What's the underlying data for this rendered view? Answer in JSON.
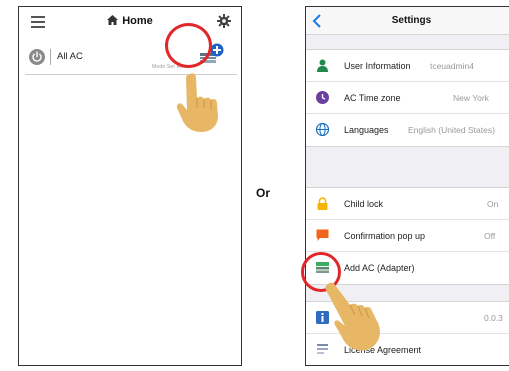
{
  "home_screen": {
    "title": "Home",
    "ac_item": {
      "name": "All AC",
      "status_labels": "Mode   Set   Room"
    }
  },
  "separator": {
    "label": "Or"
  },
  "settings_screen": {
    "title": "Settings",
    "section_1": [
      {
        "label": "User Information",
        "value": "tceuadmin4",
        "icon": "user-icon",
        "icon_color": "#1f8a4c"
      },
      {
        "label": "AC Time zone",
        "value": "New York",
        "icon": "clock-icon",
        "icon_color": "#6b3fa0"
      },
      {
        "label": "Languages",
        "value": "English (United States)",
        "icon": "globe-icon",
        "icon_color": "#1a6fc4"
      }
    ],
    "section_2": [
      {
        "label": "Child lock",
        "value": "On",
        "icon": "lock-icon",
        "icon_color": "#f5b400"
      },
      {
        "label": "Confirmation pop up",
        "value": "Off",
        "icon": "chat-icon",
        "icon_color": "#f0641e"
      },
      {
        "label": "Add AC (Adapter)",
        "value": "",
        "icon": "add-ac-adapter-icon",
        "icon_color": "#3cae5f"
      }
    ],
    "section_3": [
      {
        "label": "",
        "value": "0.0.3",
        "icon": "info-icon",
        "icon_color": "#2f6bbf"
      },
      {
        "label": "License Agreement",
        "value": "",
        "icon": "document-icon",
        "icon_color": "#7a8aa8"
      }
    ]
  },
  "colors": {
    "highlight": "#e0272a",
    "hand": "#e8b766"
  }
}
